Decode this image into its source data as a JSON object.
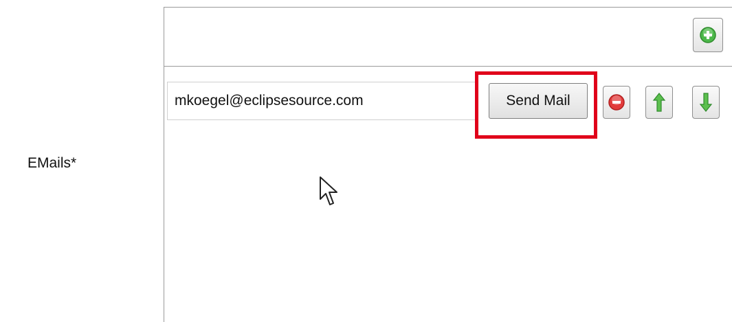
{
  "form": {
    "field_label": "EMails*",
    "emails": [
      {
        "value": "mkoegel@eclipsesource.com",
        "send_label": "Send Mail"
      }
    ]
  },
  "icons": {
    "add": "add-icon",
    "remove": "remove-icon",
    "move_up": "arrow-up-icon",
    "move_down": "arrow-down-icon",
    "cursor": "mouse-pointer-icon"
  },
  "colors": {
    "highlight": "#e0001a",
    "add_green": "#4cb84a",
    "remove_red": "#e23b3b",
    "arrow_green": "#44a33a"
  }
}
